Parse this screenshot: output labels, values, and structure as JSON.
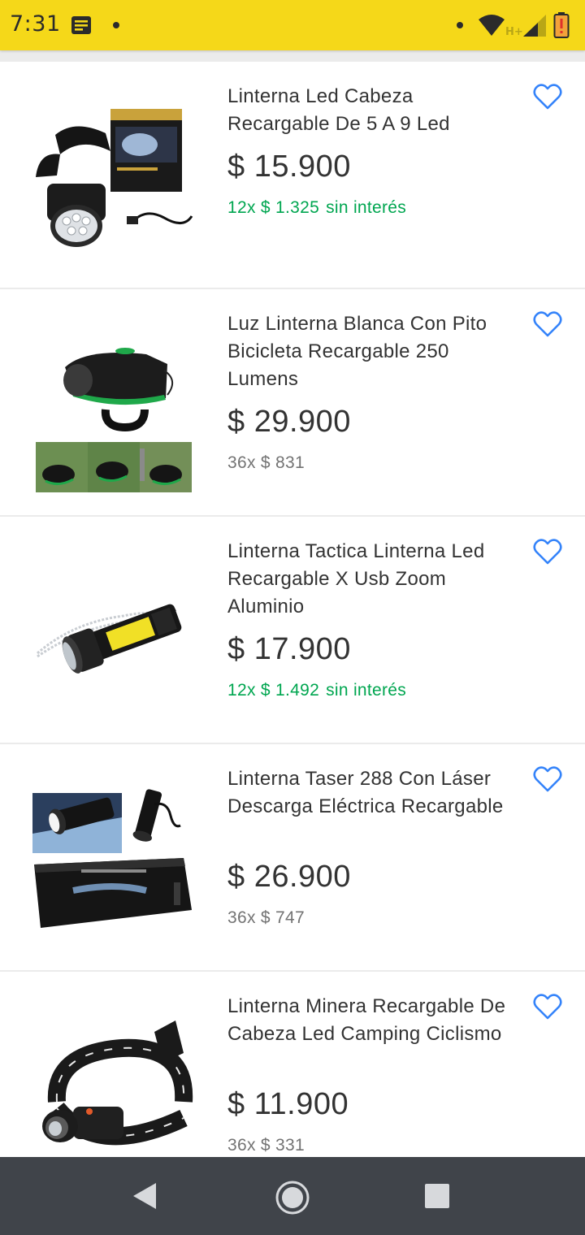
{
  "status_bar": {
    "time": "7:31",
    "network_type": "H+",
    "icons": [
      "notification-icon",
      "wifi-icon",
      "signal-icon",
      "battery-icon"
    ]
  },
  "colors": {
    "status_bar": "#f5d819",
    "installment_free": "#00a650",
    "installment_plain": "#737373",
    "favorite": "#3483fa",
    "nav_bar": "#40444a"
  },
  "products": [
    {
      "title": "Linterna Led Cabeza Recargable De 5 A 9 Led",
      "price": "$ 15.900",
      "installments": "12x $ 1.325",
      "interest_free": "sin interés",
      "image": "headlamp-box"
    },
    {
      "title": "Luz Linterna Blanca Con Pito Bicicleta Recargable 250 Lumens",
      "price": "$ 29.900",
      "installments": "36x $ 831",
      "interest_free": "",
      "image": "bike-light"
    },
    {
      "title": "Linterna Tactica Linterna Led Recargable X Usb Zoom Aluminio",
      "price": "$ 17.900",
      "installments": "12x $ 1.492",
      "interest_free": "sin interés",
      "image": "tactical-flashlight"
    },
    {
      "title": "Linterna Taser 288 Con Láser Descarga Eléctrica Recargable",
      "price": "$ 26.900",
      "installments": "36x $ 747",
      "interest_free": "",
      "image": "taser-flashlight"
    },
    {
      "title": "Linterna Minera Recargable De Cabeza Led Camping Ciclismo",
      "price": "$ 11.900",
      "installments": "36x $ 331",
      "interest_free": "",
      "image": "headlamp-strap"
    }
  ],
  "navigation": {
    "buttons": [
      "back-icon",
      "home-icon",
      "recents-icon"
    ]
  }
}
